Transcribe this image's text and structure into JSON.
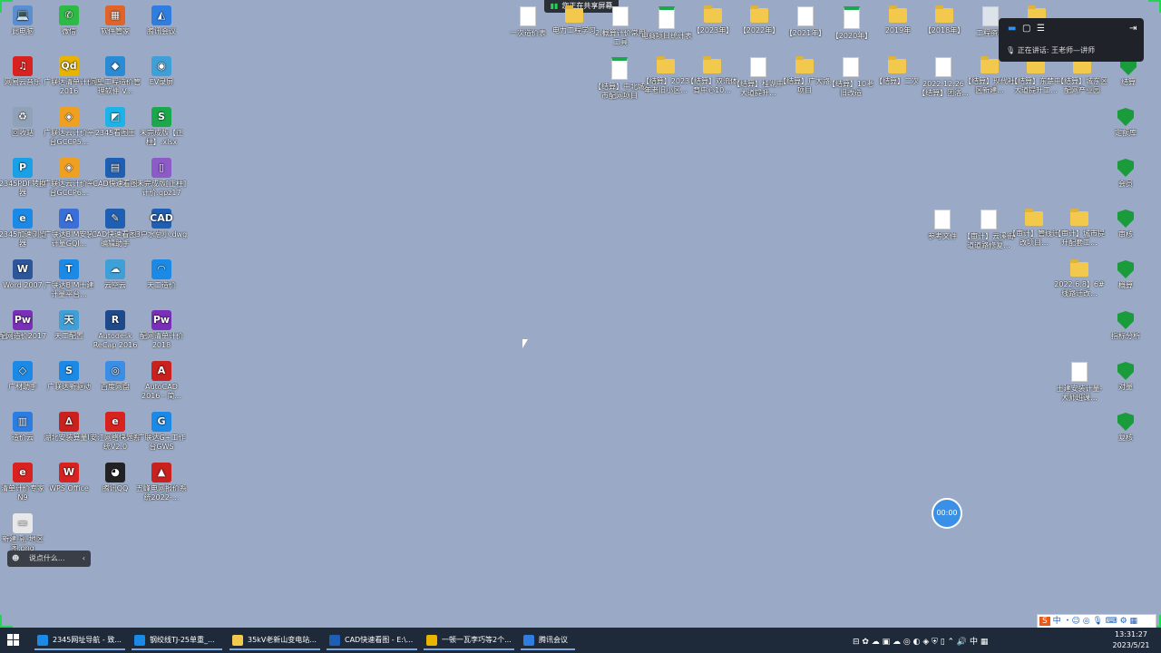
{
  "desktop": {
    "left_icons": [
      {
        "label": "此电脑",
        "kind": "app",
        "glyph": "💻",
        "color": "#5b8fd1"
      },
      {
        "label": "微信",
        "kind": "app",
        "glyph": "✆",
        "color": "#2dbb45"
      },
      {
        "label": "软件管家",
        "kind": "app",
        "glyph": "▦",
        "color": "#e0632a"
      },
      {
        "label": "腾讯会议",
        "kind": "app",
        "glyph": "◭",
        "color": "#2f7de1"
      },
      {
        "label": "网易云音乐",
        "kind": "app",
        "glyph": "♫",
        "color": "#d8221f"
      },
      {
        "label": "广联达清单计价2016",
        "kind": "app",
        "glyph": "Qd",
        "color": "#e8b400"
      },
      {
        "label": "同望工程造价管理软件 V...",
        "kind": "app",
        "glyph": "◆",
        "color": "#2a8ad4"
      },
      {
        "label": "EV录屏",
        "kind": "app",
        "glyph": "◉",
        "color": "#3fa0d8"
      },
      {
        "label": "回收站",
        "kind": "app",
        "glyph": "♻",
        "color": "#8fa2b8"
      },
      {
        "label": "广联达云计价平台GCCP5...",
        "kind": "app",
        "glyph": "◈",
        "color": "#f0a020"
      },
      {
        "label": "2345看图王",
        "kind": "app",
        "glyph": "◩",
        "color": "#1cb4e8"
      },
      {
        "label": "未完成版【正柱】.xlsx",
        "kind": "app",
        "glyph": "S",
        "color": "#1aa84b"
      },
      {
        "label": "2345PDF转换器",
        "kind": "app",
        "glyph": "P",
        "color": "#1aa0e6"
      },
      {
        "label": "广联达云计价平台GCCP6...",
        "kind": "app",
        "glyph": "◈",
        "color": "#f0a020"
      },
      {
        "label": "CAD快速看图",
        "kind": "app",
        "glyph": "▤",
        "color": "#1e5fb4"
      },
      {
        "label": "未完成版[正柱]计价.qpz17",
        "kind": "app",
        "glyph": "▯",
        "color": "#8c5bc7"
      },
      {
        "label": "2345加速浏览器",
        "kind": "app",
        "glyph": "e",
        "color": "#1a8ae6"
      },
      {
        "label": "广联达BIM安装计量GQI...",
        "kind": "app",
        "glyph": "A",
        "color": "#3a6fd8"
      },
      {
        "label": "CAD快速看图-编辑助手",
        "kind": "app",
        "glyph": "✎",
        "color": "#1e5fb4"
      },
      {
        "label": "3户水总小.dwg",
        "kind": "app",
        "glyph": "CAD",
        "color": "#1e5fb4"
      },
      {
        "label": "Word 2007",
        "kind": "app",
        "glyph": "W",
        "color": "#2b579a"
      },
      {
        "label": "广联达BIM土建计量平台...",
        "kind": "app",
        "glyph": "T",
        "color": "#1a8ae6"
      },
      {
        "label": "云空云",
        "kind": "app",
        "glyph": "☁",
        "color": "#3fa0d8"
      },
      {
        "label": "天工造价",
        "kind": "app",
        "glyph": "◠",
        "color": "#1a8ae6"
      },
      {
        "label": "配网造价2017",
        "kind": "app",
        "glyph": "Pw",
        "color": "#7a2fb8"
      },
      {
        "label": "天工配置",
        "kind": "app",
        "glyph": "天",
        "color": "#3fa0d8"
      },
      {
        "label": "Autodesk ReCap 2016",
        "kind": "app",
        "glyph": "R",
        "color": "#1e4a8c"
      },
      {
        "label": "配网清单计价2018",
        "kind": "app",
        "glyph": "Pw",
        "color": "#7a2fb8"
      },
      {
        "label": "广材助手",
        "kind": "app",
        "glyph": "◇",
        "color": "#1a8ae6"
      },
      {
        "label": "广联达新驱动",
        "kind": "app",
        "glyph": "S",
        "color": "#1a8ae6"
      },
      {
        "label": "百度网盘",
        "kind": "app",
        "glyph": "◎",
        "color": "#3a8ee6"
      },
      {
        "label": "AutoCAD 2016 - 简...",
        "kind": "app",
        "glyph": "A",
        "color": "#c8211e"
      },
      {
        "label": "造价云",
        "kind": "app",
        "glyph": "▥",
        "color": "#2a7de1"
      },
      {
        "label": "湖北安装算量III",
        "kind": "app",
        "glyph": "∆",
        "color": "#c8211e"
      },
      {
        "label": "安江网络快题系统V2.0",
        "kind": "app",
        "glyph": "e",
        "color": "#d8221f"
      },
      {
        "label": "广联达G+工作台GWS",
        "kind": "app",
        "glyph": "G",
        "color": "#1a8ae6"
      },
      {
        "label": "清单计价专家N9",
        "kind": "app",
        "glyph": "e",
        "color": "#d8221f"
      },
      {
        "label": "WPS Office",
        "kind": "app",
        "glyph": "W",
        "color": "#d8221f"
      },
      {
        "label": "腾讯QQ",
        "kind": "app",
        "glyph": "◕",
        "color": "#222"
      },
      {
        "label": "五峰电网报价系统2022-...",
        "kind": "app",
        "glyph": "▲",
        "color": "#c8211e"
      },
      {
        "label": "新建-副-地区图.png",
        "kind": "app",
        "glyph": "▭",
        "color": "#e8e8e8"
      }
    ],
    "top_right_icons": [
      {
        "label": "一次造价表",
        "kind": "doc"
      },
      {
        "label": "电力工程学习",
        "kind": "folder"
      },
      {
        "label": "2.概算计价常用工具",
        "kind": "doc"
      },
      {
        "label": "电商项目统计表",
        "kind": "sheet"
      },
      {
        "label": "【2023年】",
        "kind": "folder"
      },
      {
        "label": "【2022年】",
        "kind": "folder"
      },
      {
        "label": "【2021年】",
        "kind": "doc"
      },
      {
        "label": "【2020年】",
        "kind": "sheet"
      },
      {
        "label": "2019年",
        "kind": "folder"
      },
      {
        "label": "【2018年】",
        "kind": "folder"
      },
      {
        "label": "工程资料",
        "kind": "drive"
      },
      {
        "label": "结算",
        "kind": "folder"
      },
      {
        "label": "【结算】中北城市配网项目",
        "kind": "sheet"
      },
      {
        "label": "【结算】2023年老旧小区...",
        "kind": "folder"
      },
      {
        "label": "【结算】双流体育中心10...",
        "kind": "folder"
      },
      {
        "label": "【结算】桂湖中大道提升...",
        "kind": "doc"
      },
      {
        "label": "【结算】广大路项目",
        "kind": "folder"
      },
      {
        "label": "【结算】10老旧改造",
        "kind": "doc"
      },
      {
        "label": "【结算】二次",
        "kind": "folder"
      },
      {
        "label": "2022.12.26【结算】团洛...",
        "kind": "doc"
      },
      {
        "label": "【结算】现代社区新建...",
        "kind": "folder"
      },
      {
        "label": "【结算】东楚中大道提升工...",
        "kind": "folder"
      },
      {
        "label": "【结算】城东区配网产业园",
        "kind": "folder"
      },
      {
        "label": "结算",
        "kind": "shield"
      }
    ],
    "right_column_icons": [
      {
        "label": "定额库",
        "kind": "shield"
      },
      {
        "label": "会员",
        "kind": "shield"
      },
      {
        "label": "审核",
        "kind": "shield"
      },
      {
        "label": "概算",
        "kind": "shield"
      },
      {
        "label": "指标分析",
        "kind": "shield"
      },
      {
        "label": "对量",
        "kind": "shield"
      },
      {
        "label": "复核",
        "kind": "shield"
      }
    ],
    "middle_right_icons": [
      {
        "label": "参考文件",
        "kind": "doc"
      },
      {
        "label": "【审计】云溪街道道路修复...",
        "kind": "doc"
      },
      {
        "label": "【审计】管线迁改项目...",
        "kind": "folder"
      },
      {
        "label": "【审计】城市提升配套工...",
        "kind": "folder"
      },
      {
        "label": "2022.6.8】6#线路迁改...",
        "kind": "folder"
      },
      {
        "label": "土建安装计量-大师班课...",
        "kind": "doc"
      }
    ]
  },
  "screen_share": {
    "banner_text": "您正在共享屏幕",
    "speaking_label": "正在讲话:",
    "speaker_name": "王老师—讲师"
  },
  "timer": {
    "value": "00:00"
  },
  "chat": {
    "placeholder": "说点什么..."
  },
  "taskbar": {
    "items": [
      {
        "label": "2345网址导航 - 致...",
        "color": "#1a8ae6"
      },
      {
        "label": "钢绞线TJ-25单重_...",
        "color": "#1a8ae6"
      },
      {
        "label": "35kV老新山变电站...",
        "color": "#f2c94c"
      },
      {
        "label": "CAD快速看图 - E:\\...",
        "color": "#1e5fb4"
      },
      {
        "label": "一顿一瓦李巧等2个...",
        "color": "#e8b400"
      },
      {
        "label": "腾讯会议",
        "color": "#2f7de1"
      }
    ],
    "time": "13:31:27",
    "date": "2023/5/21",
    "ime_lang": "中"
  }
}
